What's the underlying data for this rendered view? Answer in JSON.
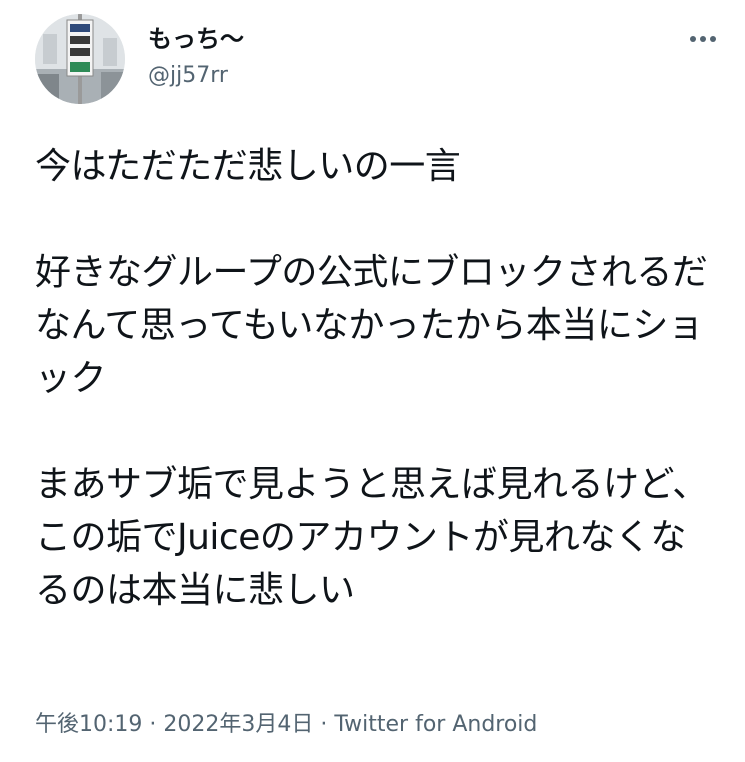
{
  "author": {
    "display_name": "もっち〜",
    "handle": "@jj57rr",
    "avatar_icon": "street-sign-photo-avatar"
  },
  "tweet": {
    "text": "今はただただ悲しいの一言\n\n好きなグループの公式にブロックされるだなんて思ってもいなかったから本当にショック\n\nまあサブ垢で見ようと思えば見れるけど、この垢でJuiceのアカウントが見れなくなるのは本当に悲しい"
  },
  "meta": {
    "time": "午後10:19",
    "separator": " · ",
    "date": "2022年3月4日",
    "source": "Twitter for Android"
  },
  "icons": {
    "more": "more-horizontal-icon"
  },
  "colors": {
    "text": "#0f1419",
    "secondary": "#536471",
    "background": "#ffffff"
  }
}
